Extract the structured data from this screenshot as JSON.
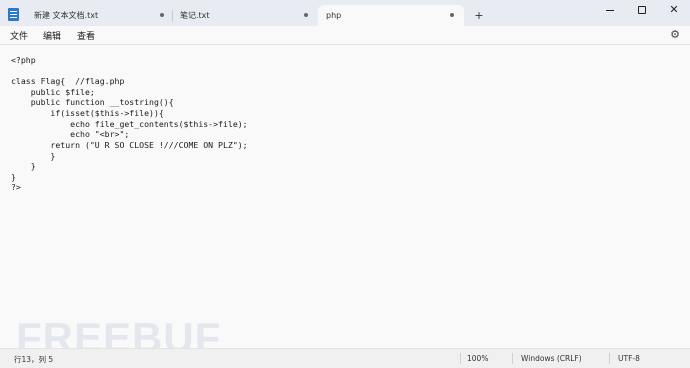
{
  "titlebar": {
    "tabs": [
      {
        "label": "新建 文本文档.txt",
        "modified": true
      },
      {
        "label": "笔记.txt",
        "modified": true
      },
      {
        "label": "php",
        "modified": true,
        "active": true
      }
    ],
    "new_tab": "+",
    "window_controls": {
      "minimize": "minimize-icon",
      "maximize": "maximize-icon",
      "close": "✕"
    }
  },
  "menubar": {
    "items": [
      "文件",
      "编辑",
      "查看"
    ],
    "settings_icon": "gear-icon"
  },
  "editor": {
    "lines": [
      "<?php",
      "",
      "class Flag{  //flag.php",
      "    public $file;",
      "    public function __tostring(){",
      "        if(isset($this->file)){",
      "            echo file_get_contents($this->file);",
      "            echo \"<br>\";",
      "        return (\"U R SO CLOSE !///COME ON PLZ\");",
      "        }",
      "    }",
      "}",
      "?>"
    ]
  },
  "watermark": "FREEBUF",
  "statusbar": {
    "position": "行13，列 5",
    "zoom": "100%",
    "line_ending": "Windows (CRLF)",
    "encoding": "UTF-8"
  }
}
